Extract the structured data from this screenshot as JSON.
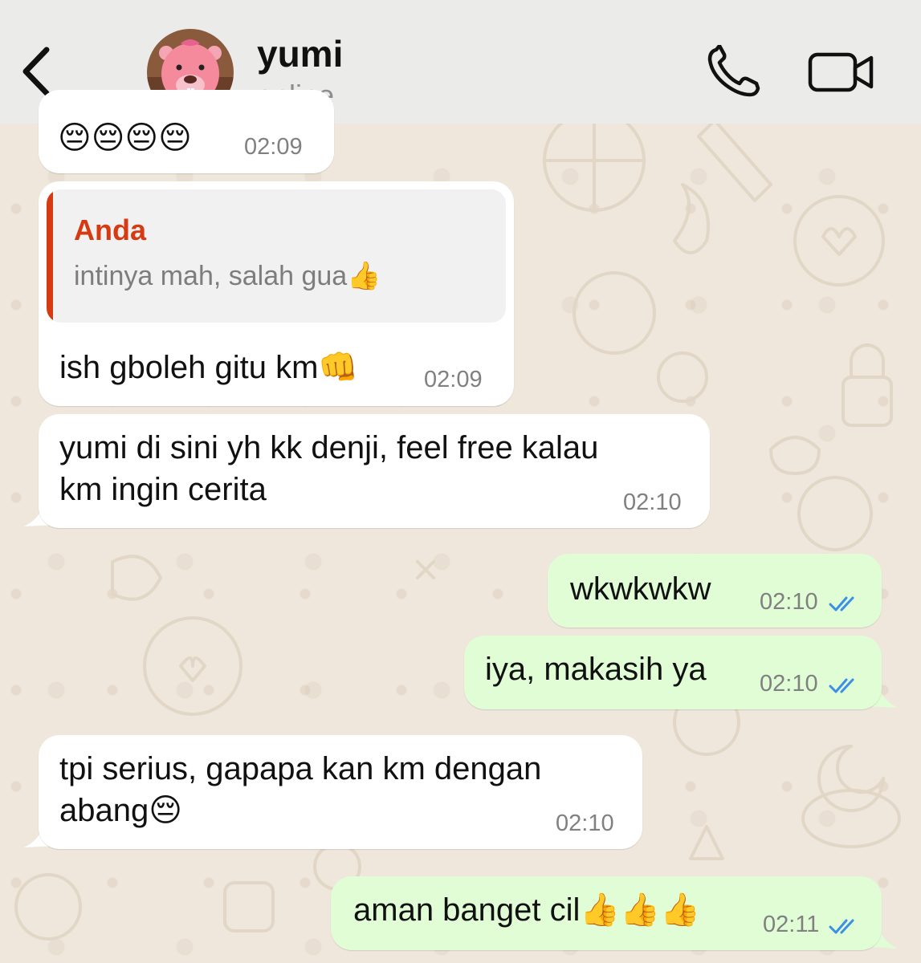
{
  "header": {
    "contact_name": "yumi",
    "contact_status": "online"
  },
  "messages": [
    {
      "direction": "in",
      "text": "😔😔😔😔",
      "time": "02:09"
    },
    {
      "direction": "in",
      "quote_author": "Anda",
      "quote_text": "intinya mah, salah gua👍",
      "text": "ish gboleh gitu km👊",
      "time": "02:09"
    },
    {
      "direction": "in",
      "text": "yumi di sini yh kk denji, feel free kalau\nkm ingin cerita",
      "time": "02:10"
    },
    {
      "direction": "out",
      "text": "wkwkwkw",
      "time": "02:10",
      "read": true
    },
    {
      "direction": "out",
      "text": "iya, makasih ya",
      "time": "02:10",
      "read": true
    },
    {
      "direction": "in",
      "text": "tpi serius, gapapa kan km dengan\nabang😔",
      "time": "02:10"
    },
    {
      "direction": "out",
      "text": "aman banget cil👍👍👍",
      "time": "02:11",
      "read": true
    }
  ],
  "colors": {
    "header_bg": "#ebebea",
    "chat_bg": "#efe7dc",
    "incoming_bubble": "#ffffff",
    "outgoing_bubble": "#e1fdd6",
    "quote_accent": "#d63a12",
    "read_tick": "#3b8fe5"
  },
  "icons": {
    "back": "chevron-left-icon",
    "call": "phone-icon",
    "video": "video-camera-icon",
    "read_receipt": "double-check-icon"
  }
}
